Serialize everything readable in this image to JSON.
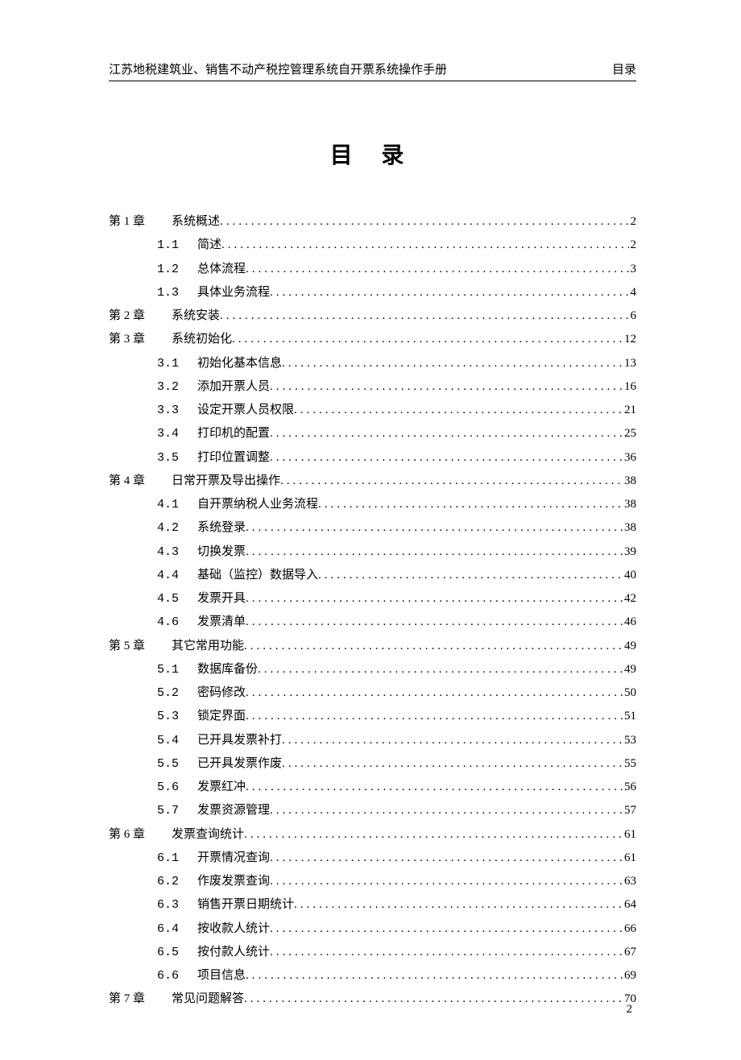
{
  "header": {
    "left": "江苏地税建筑业、销售不动产税控管理系统自开票系统操作手册",
    "right": "目录"
  },
  "title": "目 录",
  "footer_page": "2",
  "toc": [
    {
      "type": "chapter",
      "chapter": "第 1 章",
      "label": "系统概述",
      "page": "2"
    },
    {
      "type": "section",
      "section": "1.1",
      "label": "简述",
      "page": "2"
    },
    {
      "type": "section",
      "section": "1.2",
      "label": "总体流程",
      "page": "3"
    },
    {
      "type": "section",
      "section": "1.3",
      "label": "具体业务流程",
      "page": "4"
    },
    {
      "type": "chapter",
      "chapter": "第 2 章",
      "label": "系统安装",
      "page": "6"
    },
    {
      "type": "chapter",
      "chapter": "第 3 章",
      "label": "系统初始化",
      "page": "12"
    },
    {
      "type": "section",
      "section": "3.1",
      "label": "初始化基本信息",
      "page": "13"
    },
    {
      "type": "section",
      "section": "3.2",
      "label": "添加开票人员",
      "page": "16"
    },
    {
      "type": "section",
      "section": "3.3",
      "label": "设定开票人员权限",
      "page": "21"
    },
    {
      "type": "section",
      "section": "3.4",
      "label": "打印机的配置",
      "page": "25"
    },
    {
      "type": "section",
      "section": "3.5",
      "label": "打印位置调整",
      "page": "36"
    },
    {
      "type": "chapter",
      "chapter": "第 4 章",
      "label": "日常开票及导出操作",
      "page": "38"
    },
    {
      "type": "section",
      "section": "4.1",
      "label": "自开票纳税人业务流程",
      "page": "38"
    },
    {
      "type": "section",
      "section": "4.2",
      "label": "系统登录",
      "page": "38"
    },
    {
      "type": "section",
      "section": "4.3",
      "label": "切换发票",
      "page": "39"
    },
    {
      "type": "section",
      "section": "4.4",
      "label": "基础（监控）数据导入",
      "page": "40"
    },
    {
      "type": "section",
      "section": "4.5",
      "label": "发票开具",
      "page": "42"
    },
    {
      "type": "section",
      "section": "4.6",
      "label": "发票清单",
      "page": "46"
    },
    {
      "type": "chapter",
      "chapter": "第 5 章",
      "label": "其它常用功能",
      "page": "49"
    },
    {
      "type": "section",
      "section": "5.1",
      "label": "数据库备份",
      "page": "49"
    },
    {
      "type": "section",
      "section": "5.2",
      "label": "密码修改",
      "page": "50"
    },
    {
      "type": "section",
      "section": "5.3",
      "label": "锁定界面",
      "page": "51"
    },
    {
      "type": "section",
      "section": "5.4",
      "label": "已开具发票补打",
      "page": "53"
    },
    {
      "type": "section",
      "section": "5.5",
      "label": "已开具发票作废",
      "page": "55"
    },
    {
      "type": "section",
      "section": "5.6",
      "label": "发票红冲",
      "page": "56"
    },
    {
      "type": "section",
      "section": "5.7",
      "label": "发票资源管理",
      "page": "57"
    },
    {
      "type": "chapter",
      "chapter": "第 6 章",
      "label": "发票查询统计",
      "page": "61"
    },
    {
      "type": "section",
      "section": "6.1",
      "label": "开票情况查询",
      "page": "61"
    },
    {
      "type": "section",
      "section": "6.2",
      "label": "作废发票查询",
      "page": "63"
    },
    {
      "type": "section",
      "section": "6.3",
      "label": "销售开票日期统计",
      "page": "64"
    },
    {
      "type": "section",
      "section": "6.4",
      "label": "按收款人统计",
      "page": "66"
    },
    {
      "type": "section",
      "section": "6.5",
      "label": "按付款人统计",
      "page": "67"
    },
    {
      "type": "section",
      "section": "6.6",
      "label": "项目信息",
      "page": "69"
    },
    {
      "type": "chapter",
      "chapter": "第 7 章",
      "label": "常见问题解答",
      "page": "70"
    }
  ]
}
